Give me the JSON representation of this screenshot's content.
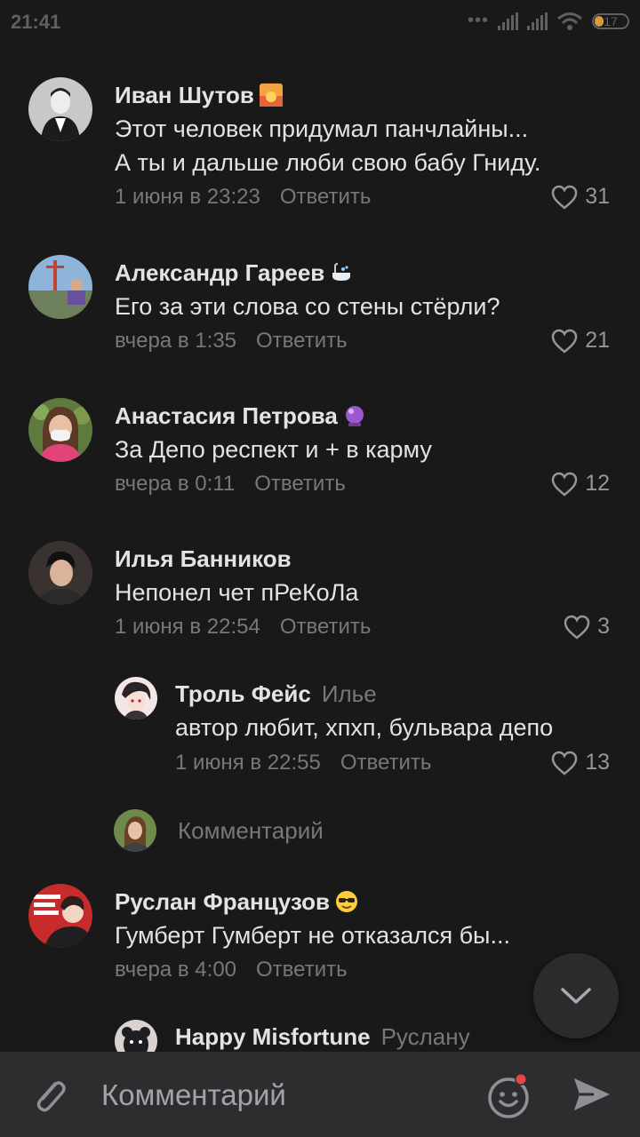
{
  "status": {
    "time": "21:41",
    "battery": "17"
  },
  "comments": [
    {
      "author": "Иван Шутов",
      "emoji": "sunset-emoji",
      "lines": [
        "Этот человек придумал панчлайны...",
        "А ты и дальше люби свою бабу Гниду."
      ],
      "date": "1 июня в 23:23",
      "reply": "Ответить",
      "likes": "31"
    },
    {
      "author": "Александр Гареев",
      "emoji": "bathtub-emoji",
      "lines": [
        "Его за эти слова со стены стёрли?"
      ],
      "date": "вчера в 1:35",
      "reply": "Ответить",
      "likes": "21"
    },
    {
      "author": "Анастасия Петрова",
      "emoji": "crystal-ball-emoji",
      "lines": [
        "За Депо респект и + в карму"
      ],
      "date": "вчера в 0:11",
      "reply": "Ответить",
      "likes": "12"
    },
    {
      "author": "Илья Банников",
      "lines": [
        "Непонел чет пРеКоЛа"
      ],
      "date": "1 июня в 22:54",
      "reply": "Ответить",
      "likes": "3"
    },
    {
      "author": "Троль Фейс",
      "reply_to": "Илье",
      "lines": [
        "автор любит, хпхп, бульвара депо"
      ],
      "date": "1 июня в 22:55",
      "reply": "Ответить",
      "likes": "13"
    },
    {
      "author": "Руслан Французов",
      "emoji": "sunglasses-emoji",
      "lines": [
        "Гумберт Гумберт не отказался бы..."
      ],
      "date": "вчера в 4:00",
      "reply": "Ответить"
    },
    {
      "author": "Happy Misfortune",
      "reply_to": "Руслану"
    }
  ],
  "thread_input": {
    "placeholder": "Комментарий"
  },
  "composer": {
    "placeholder": "Комментарий"
  },
  "colors": {
    "background": "#19191a",
    "text": "#e1e3e6",
    "secondary": "#76787a",
    "composer": "#2c2d2e",
    "badge": "#e64646"
  }
}
